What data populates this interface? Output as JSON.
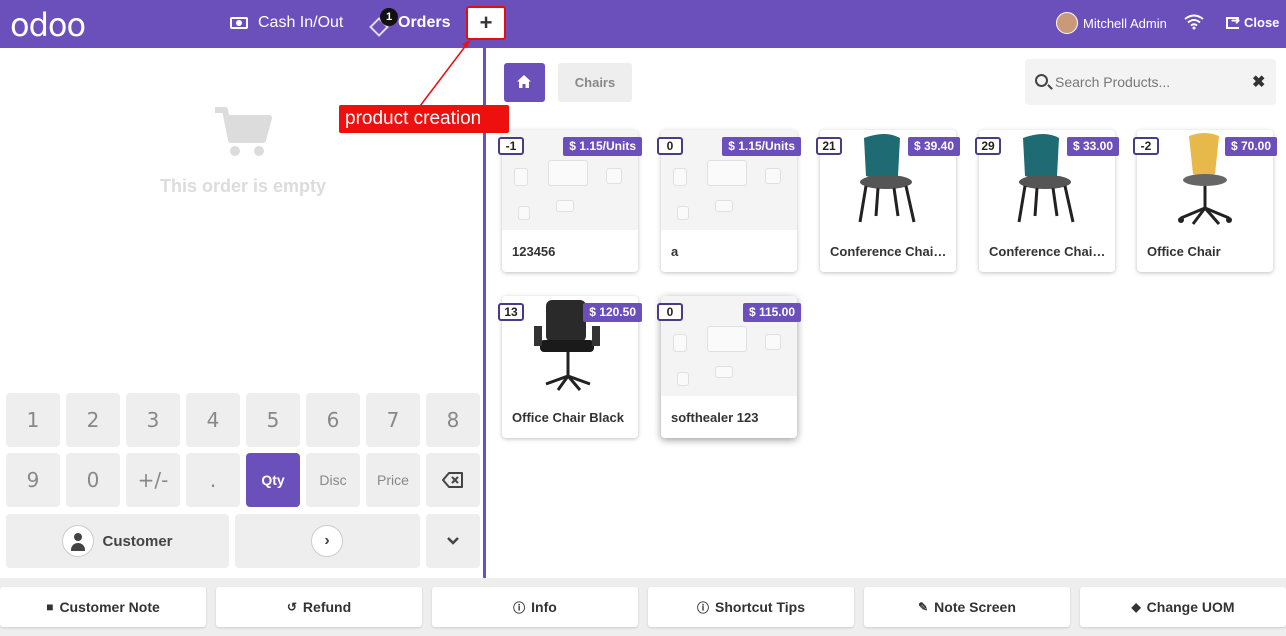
{
  "header": {
    "logo": "odoo",
    "cash_label": "Cash In/Out",
    "orders_label": "Orders",
    "orders_badge": "1",
    "new_order_symbol": "+",
    "user_name": "Mitchell Admin",
    "close_label": "Close"
  },
  "annotation": {
    "text": "product creation"
  },
  "order": {
    "empty_text": "This order is empty"
  },
  "numpad": {
    "row1": [
      "1",
      "2",
      "3",
      "4",
      "5",
      "6",
      "7",
      "8"
    ],
    "row2": [
      "9",
      "0",
      "+/-",
      ".",
      "Qty",
      "Disc",
      "Price",
      "⌫"
    ],
    "active_mode": "Qty",
    "customer_label": "Customer",
    "next_symbol": "›",
    "more_symbol": "⌄"
  },
  "categories": {
    "current": "Chairs"
  },
  "search": {
    "placeholder": "Search Products...",
    "value": ""
  },
  "products": [
    {
      "name": "123456",
      "qty": "-1",
      "price": "$ 1.15/Units",
      "image": "placeholder"
    },
    {
      "name": "a",
      "qty": "0",
      "price": "$ 1.15/Units",
      "image": "placeholder"
    },
    {
      "name": "Conference Chair (Steel)",
      "qty": "21",
      "price": "$ 39.40",
      "image": "teal-chair"
    },
    {
      "name": "Conference Chair (Aluminium)",
      "qty": "29",
      "price": "$ 33.00",
      "image": "teal-chair"
    },
    {
      "name": "Office Chair",
      "qty": "-2",
      "price": "$ 70.00",
      "image": "yellow-swivel-chair"
    },
    {
      "name": "Office Chair Black",
      "qty": "13",
      "price": "$ 120.50",
      "image": "black-office-chair"
    },
    {
      "name": "softhealer 123",
      "qty": "0",
      "price": "$ 115.00",
      "image": "placeholder"
    }
  ],
  "footer": {
    "buttons": [
      "Customer Note",
      "Refund",
      "Info",
      "Shortcut Tips",
      "Note Screen",
      "Change UOM"
    ]
  },
  "colors": {
    "primary": "#6b4fbb",
    "annotation": "#ee0f0f",
    "panel_bg": "#eeeeee"
  }
}
